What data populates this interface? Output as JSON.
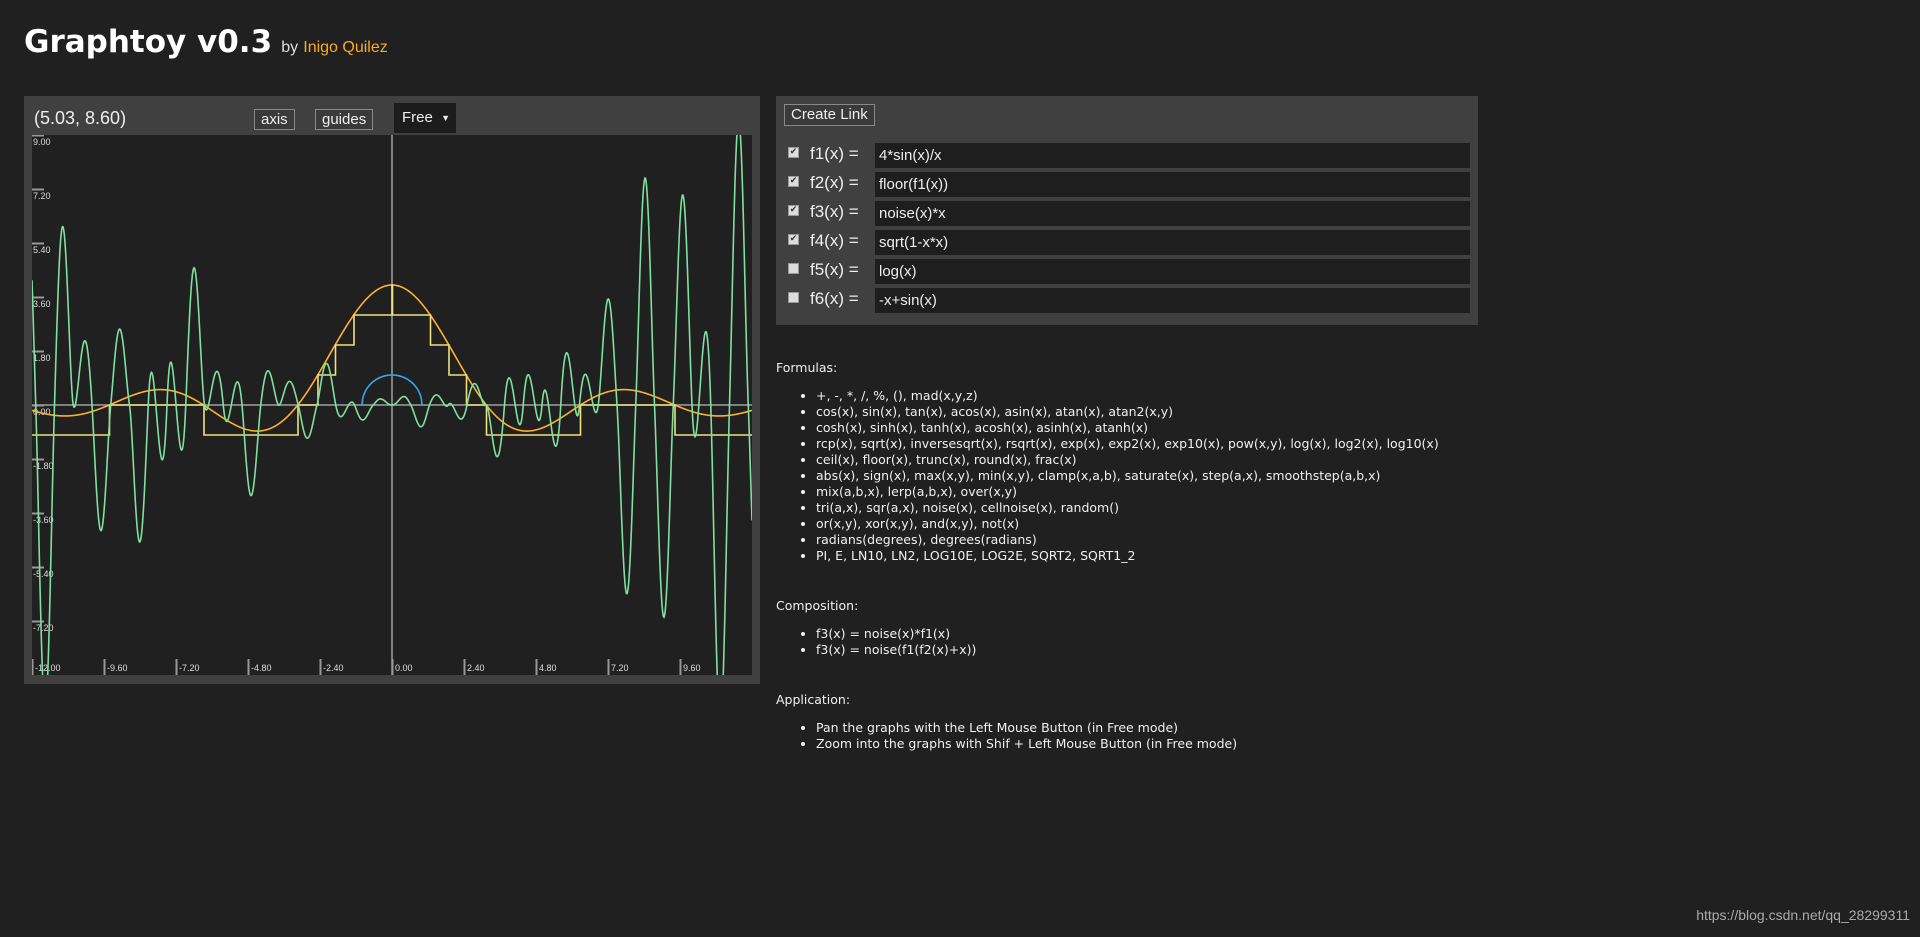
{
  "header": {
    "title": "Graphtoy v0.3",
    "by": "by",
    "author": "Inigo Quilez",
    "author_color": "#ffa820"
  },
  "graph": {
    "coords": "(5.03, 8.60)",
    "axis_label": "axis",
    "guides_label": "guides",
    "mode": "Free",
    "mode_icon": "triangle-down-icon"
  },
  "chart_data": {
    "type": "line",
    "xlim": [
      -12,
      12
    ],
    "ylim": [
      -9,
      9
    ],
    "x_ticks": [
      "-12.00",
      "-9.60",
      "-7.20",
      "-4.80",
      "-2.40",
      "0.00",
      "2.40",
      "4.80",
      "7.20",
      "9.60"
    ],
    "y_ticks": [
      "9.00",
      "7.20",
      "5.40",
      "3.60",
      "1.80",
      "0.00",
      "-1.80",
      "-3.60",
      "-5.40",
      "-7.20"
    ],
    "axes_color": "#a0a0a0",
    "series": [
      {
        "formula": "4*sin(x)/x",
        "color": "#ffb030"
      },
      {
        "formula": "floor(f1(x))",
        "color": "#f0e080"
      },
      {
        "formula": "noise(x)*x",
        "color": "#80e0a0"
      },
      {
        "formula": "sqrt(1-x*x)",
        "color": "#30a8f0"
      }
    ]
  },
  "functions": {
    "create_link": "Create Link",
    "rows": [
      {
        "label": "f1(x) =",
        "value": "4*sin(x)/x",
        "checked": true
      },
      {
        "label": "f2(x) =",
        "value": "floor(f1(x))",
        "checked": true
      },
      {
        "label": "f3(x) =",
        "value": "noise(x)*x",
        "checked": true
      },
      {
        "label": "f4(x) =",
        "value": "sqrt(1-x*x)",
        "checked": true
      },
      {
        "label": "f5(x) =",
        "value": "log(x)",
        "checked": false
      },
      {
        "label": "f6(x) =",
        "value": "-x+sin(x)",
        "checked": false
      }
    ]
  },
  "help": {
    "formulas_title": "Formulas:",
    "formulas": [
      "+, -, *, /, %, (), mad(x,y,z)",
      "cos(x), sin(x), tan(x), acos(x), asin(x), atan(x), atan2(x,y)",
      "cosh(x), sinh(x), tanh(x), acosh(x), asinh(x), atanh(x)",
      "rcp(x), sqrt(x), inversesqrt(x), rsqrt(x), exp(x), exp2(x), exp10(x), pow(x,y), log(x), log2(x), log10(x)",
      "ceil(x), floor(x), trunc(x), round(x), frac(x)",
      "abs(x), sign(x), max(x,y), min(x,y), clamp(x,a,b), saturate(x), step(a,x), smoothstep(a,b,x)",
      "mix(a,b,x), lerp(a,b,x), over(x,y)",
      "tri(a,x), sqr(a,x), noise(x), cellnoise(x), random()",
      "or(x,y), xor(x,y), and(x,y), not(x)",
      "radians(degrees), degrees(radians)",
      "PI, E, LN10, LN2, LOG10E, LOG2E, SQRT2, SQRT1_2"
    ],
    "composition_title": "Composition:",
    "composition": [
      "f3(x) = noise(x)*f1(x)",
      "f3(x) = noise(f1(f2(x)+x))"
    ],
    "application_title": "Application:",
    "application": [
      "Pan the graphs with the Left Mouse Button (in Free mode)",
      "Zoom into the graphs with Shif + Left Mouse Button (in Free mode)"
    ]
  },
  "watermark": "https://blog.csdn.net/qq_28299311"
}
